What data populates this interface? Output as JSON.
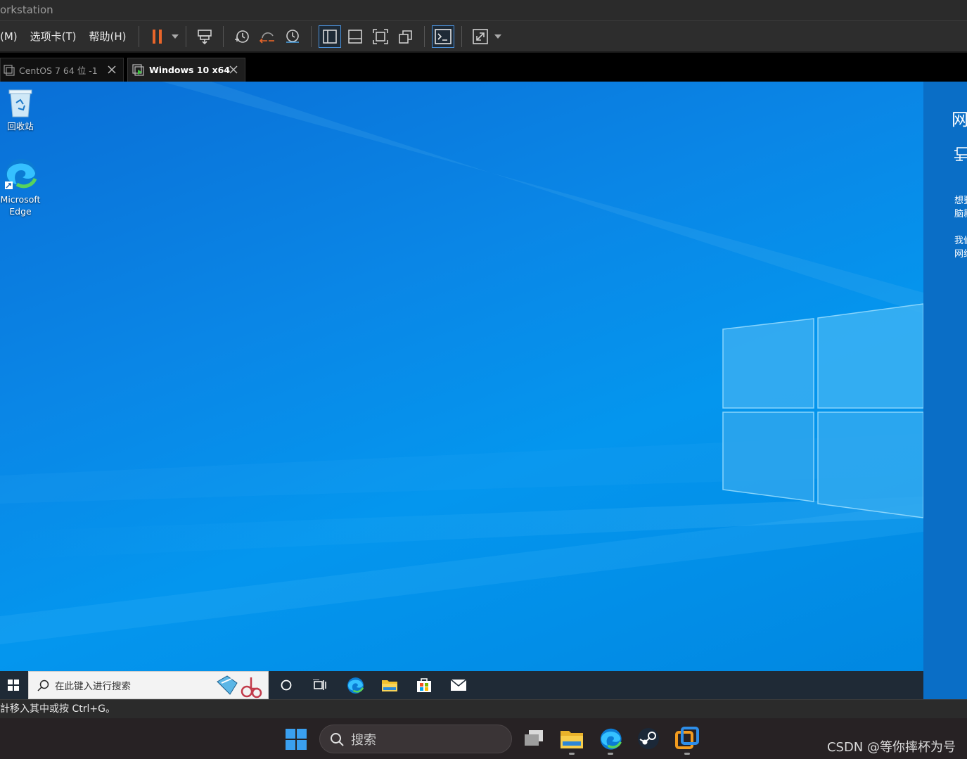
{
  "window": {
    "title": "orkstation"
  },
  "menu": {
    "items": [
      {
        "label": "(M)"
      },
      {
        "label": "选项卡(T)"
      },
      {
        "label": "帮助(H)"
      }
    ]
  },
  "toolbar": {
    "buttons": [
      "pause-icon",
      "send-ctrl-alt-del-icon",
      "snapshot-icon",
      "revert-snapshot-icon",
      "snapshot-manager-icon",
      "library-view-icon",
      "thumbnail-view-icon",
      "full-screen-icon",
      "unity-icon",
      "console-view-icon",
      "stretch-view-icon"
    ],
    "accent_color": "#e8652a"
  },
  "tabs": [
    {
      "label": "CentOS 7 64 位 -1",
      "active": false
    },
    {
      "label": "Windows 10 x64",
      "active": true
    }
  ],
  "desktop": {
    "icons": [
      {
        "label": "回收站"
      },
      {
        "label_line1": "Microsoft",
        "label_line2": "Edge"
      }
    ],
    "background_color": "#0a86e6"
  },
  "side_panel": {
    "title": "网",
    "lines": [
      "想要",
      "脑新",
      "我们",
      "网络"
    ]
  },
  "guest_taskbar": {
    "search_placeholder": "在此键入进行搜索",
    "apps": [
      "cortana-icon",
      "task-view-icon",
      "edge-icon",
      "file-explorer-icon",
      "store-icon",
      "mail-icon"
    ]
  },
  "status_bar": {
    "text": "計移入其中或按 Ctrl+G。"
  },
  "host_taskbar": {
    "search_placeholder": "搜索",
    "apps": [
      "task-view-icon",
      "file-explorer-icon",
      "edge-icon",
      "steam-icon",
      "vmware-icon"
    ]
  },
  "watermark": "CSDN @等你摔杯为号"
}
